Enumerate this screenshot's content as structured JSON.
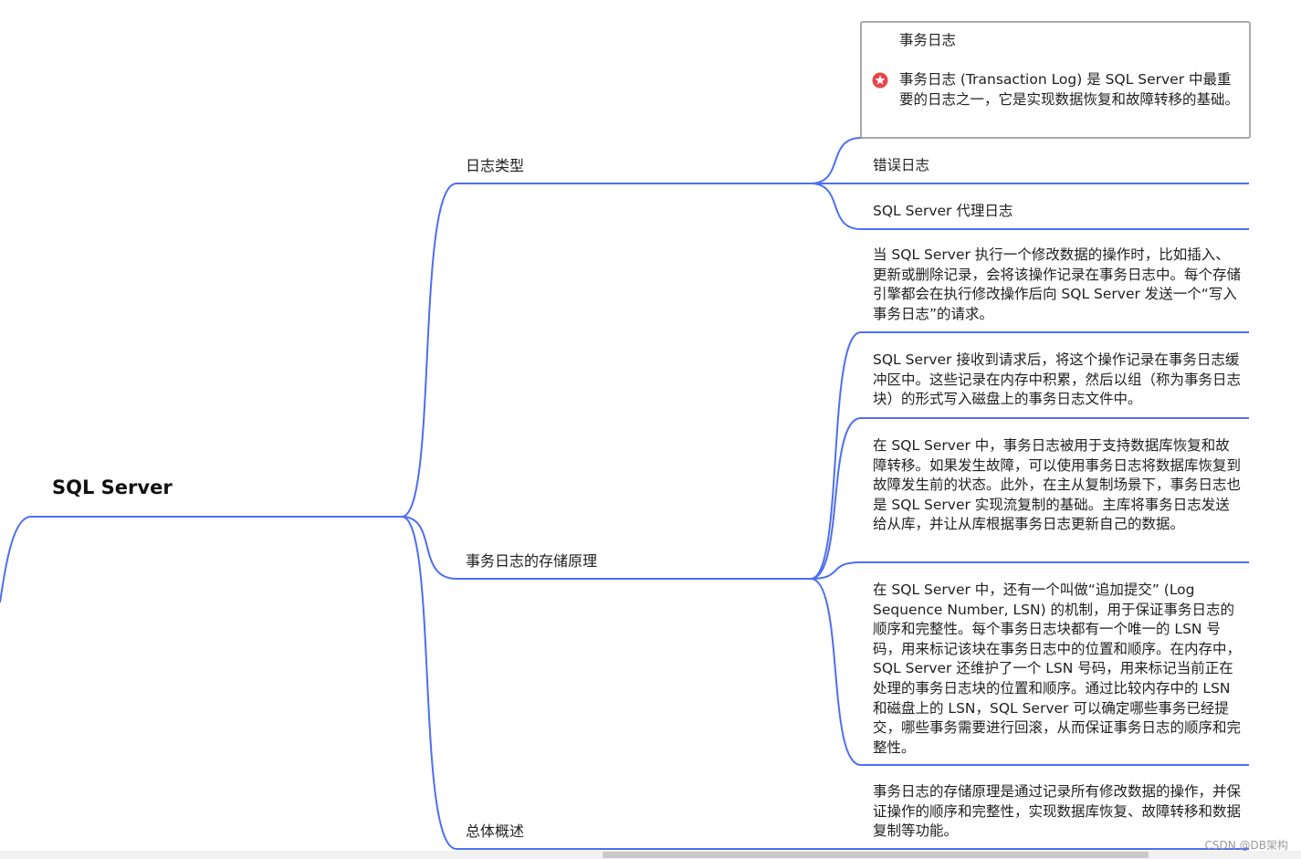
{
  "root": {
    "title": "SQL Server"
  },
  "branches": {
    "log_types": {
      "label": "日志类型",
      "children": {
        "transaction_log": {
          "label": "事务日志",
          "note": "事务日志 (Transaction Log) 是 SQL Server 中最重要的日志之一，它是实现数据恢复和故障转移的基础。"
        },
        "error_log": {
          "label": "错误日志"
        },
        "agent_log": {
          "label": "SQL Server 代理日志"
        }
      }
    },
    "storage_principle": {
      "label": "事务日志的存储原理",
      "children": [
        {
          "text": "当 SQL Server 执行一个修改数据的操作时，比如插入、更新或删除记录，会将该操作记录在事务日志中。每个存储引擎都会在执行修改操作后向 SQL Server 发送一个“写入事务日志”的请求。"
        },
        {
          "text": "SQL Server 接收到请求后，将这个操作记录在事务日志缓冲区中。这些记录在内存中积累，然后以组（称为事务日志块）的形式写入磁盘上的事务日志文件中。"
        },
        {
          "text": "在 SQL Server 中，事务日志被用于支持数据库恢复和故障转移。如果发生故障，可以使用事务日志将数据库恢复到故障发生前的状态。此外，在主从复制场景下，事务日志也是 SQL Server 实现流复制的基础。主库将事务日志发送给从库，并让从库根据事务日志更新自己的数据。"
        },
        {
          "text": "在 SQL Server 中，还有一个叫做“追加提交” (Log Sequence Number, LSN) 的机制，用于保证事务日志的顺序和完整性。每个事务日志块都有一个唯一的 LSN 号码，用来标记该块在事务日志中的位置和顺序。在内存中，SQL Server 还维护了一个 LSN 号码，用来标记当前正在处理的事务日志块的位置和顺序。通过比较内存中的 LSN 和磁盘上的 LSN，SQL Server 可以确定哪些事务已经提交，哪些事务需要进行回滚，从而保证事务日志的顺序和完整性。"
        }
      ]
    },
    "overview": {
      "label": "总体概述",
      "children": [
        {
          "text": "事务日志的存储原理是通过记录所有修改数据的操作，并保证操作的顺序和完整性，实现数据库恢复、故障转移和数据复制等功能。"
        }
      ]
    }
  },
  "icons": {
    "note_marker": "star-badge-icon"
  },
  "colors": {
    "connector": "#4d6ff0",
    "note_marker": "#e8434a",
    "card_border": "#a9a9a9"
  },
  "watermark": "CSDN @DB架构"
}
